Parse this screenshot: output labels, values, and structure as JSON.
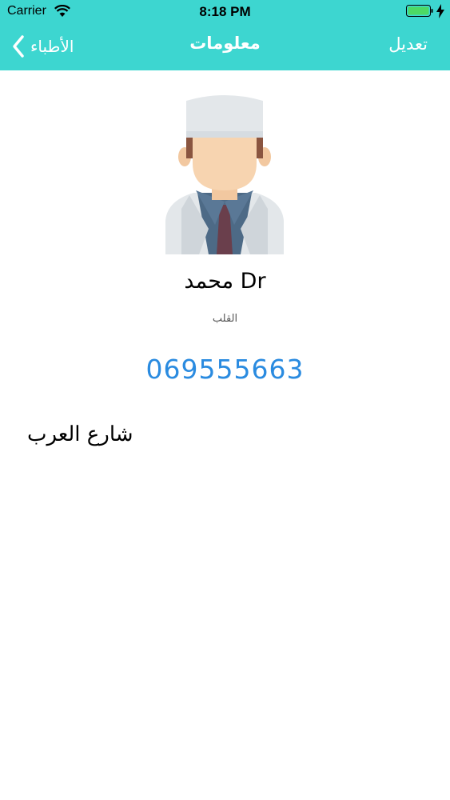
{
  "status_bar": {
    "carrier": "Carrier",
    "time": "8:18 PM",
    "icons": [
      "wifi-icon",
      "battery-icon",
      "charging-bolt-icon"
    ],
    "battery_color": "#4cd964"
  },
  "nav": {
    "back_label": "الأطباء",
    "title": "معلومات",
    "edit_label": "تعديل",
    "bar_color": "#3dd6d0"
  },
  "doctor": {
    "avatar_icon": "doctor-avatar-icon",
    "name": "محمد Dr",
    "specialty": "القلب",
    "phone": "069555663",
    "address": "شارع العرب",
    "phone_color": "#2a8be0"
  }
}
